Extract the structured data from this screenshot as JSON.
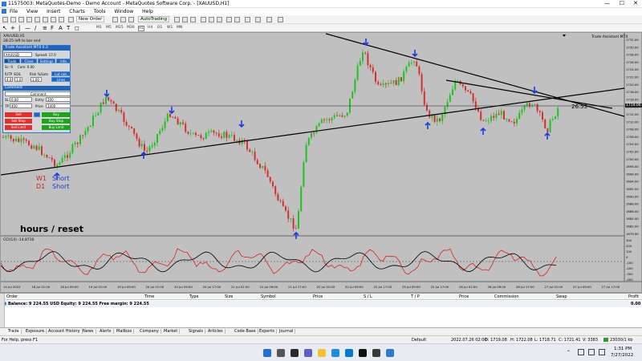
{
  "window": {
    "title": "11575003: MetaQuotes-Demo - Demo Account - MetaQuotes Software Corp. - [XAUUSD,H1]",
    "controls": [
      "—",
      "☐",
      "✕"
    ]
  },
  "menu": [
    "File",
    "View",
    "Insert",
    "Charts",
    "Tools",
    "Window",
    "Help"
  ],
  "toolbar": {
    "new_order": "New Order",
    "autotrading": "AutoTrading",
    "timeframes": [
      "M1",
      "M5",
      "M15",
      "M30",
      "H1",
      "H4",
      "D1",
      "W1",
      "MN"
    ]
  },
  "chart": {
    "symbol": "XAUUSD,H1",
    "info_lines": [
      "XAUUSD,H1",
      "28:25 left to bar end"
    ],
    "assistant_label": "Trade Assistant MT4",
    "line_value": "26.53",
    "price_axis": [
      "1732.00",
      "1730.00",
      "1728.00",
      "1726.00",
      "1724.00",
      "1722.00",
      "1720.00",
      "1718.00",
      "1716.00",
      "1714.00",
      "1712.00",
      "1710.00",
      "1708.00",
      "1706.00",
      "1704.00",
      "1702.00",
      "1700.00",
      "1698.00",
      "1696.00",
      "1694.00",
      "1692.00",
      "1690.00",
      "1688.00",
      "1686.00",
      "1684.00",
      "1682.00",
      "1679.90"
    ],
    "current_price": "1719.06",
    "time_axis": [
      "14 Jul 2022",
      "18 Jul 01:00",
      "18 Jul 09:00",
      "19 Jul 01:00",
      "19 Jul 09:00",
      "20 Jul 01:00",
      "20 Jul 09:00",
      "20 Jul 17:00",
      "21 Jul 01:00",
      "21 Jul 09:00",
      "21 Jul 17:00",
      "22 Jul 01:00",
      "22 Jul 09:00",
      "22 Jul 17:00",
      "25 Jul 09:00",
      "25 Jul 17:00",
      "26 Jul 01:00",
      "26 Jul 09:00",
      "26 Jul 17:00",
      "27 Jul 01:00",
      "27 Jul 09:00",
      "27 Jul 17:00"
    ],
    "annotation_labels": {
      "w1": "W1",
      "d1": "D1",
      "short1": "Short",
      "short2": "Short",
      "hours": "hours / reset"
    },
    "indicator_label": "CCI(14) -14.8730",
    "cci_axis": [
      "300",
      "200",
      "100",
      "0",
      "-100",
      "-200",
      "-300",
      "-400"
    ],
    "colors": {
      "background": "#c0c0c0",
      "bull": "#1fc21f",
      "bear": "#d43030",
      "arrow": "#1a3be0",
      "cci_red": "#e02020",
      "cci_black": "#000000"
    }
  },
  "trade_panel": {
    "title": "Trade Assistant MT4 0.3",
    "symbol_field": "XAUUSD",
    "spread": "Spread: 17.0",
    "tabs": [
      "Trade",
      "Close",
      "Settings",
      "Info"
    ],
    "row1": [
      "Sc: 9",
      "Com: 0.00"
    ],
    "labels": [
      "R/TP",
      "SO/L",
      "Risk %/Lots",
      "Lot calc"
    ],
    "inputs": [
      "4.0",
      "1.0",
      "1.00"
    ],
    "lines_button": "Lines",
    "comment_label": "Comment",
    "comment_value": "Comment",
    "sl_label": "SL",
    "sl_value": "0.00",
    "entry_label": "Entry",
    "entry_value": "200",
    "tp_label": "TP",
    "tp_value": "400",
    "price_label": "Price",
    "price_value": "1400",
    "sell": "Sell",
    "buy": "Buy",
    "sell_stop": "Sell Stop",
    "buy_stop": "Buy Stop",
    "sell_limit": "Sell Limit",
    "buy_limit": "Buy Limit"
  },
  "terminal": {
    "columns": [
      "Order",
      "Time",
      "Type",
      "Size",
      "Symbol",
      "Price",
      "S / L",
      "T / P",
      "Price",
      "Commission",
      "Swap",
      "Profit"
    ],
    "balance_line": "Balance: 9 224.55 USD  Equity: 9 224.55  Free margin: 9 224.55",
    "profit_total": "0.00",
    "tabs": [
      "Trade",
      "Exposure",
      "Account History",
      "News",
      "Alerts",
      "Mailbox",
      "Company",
      "Market",
      "Signals",
      "Articles",
      "Code Base",
      "Experts",
      "Journal"
    ]
  },
  "status": {
    "help": "For Help, press F1",
    "profile": "Default",
    "datetime": "2022.07.26 02:00",
    "open": "O: 1719.08",
    "high": "H: 1722.08",
    "low": "L: 1718.71",
    "close": "C: 1721.41",
    "volume": "V: 3383",
    "traffic": "23030/1 kb"
  },
  "taskbar": {
    "time": "1:31 PM",
    "date": "7/27/2022"
  }
}
